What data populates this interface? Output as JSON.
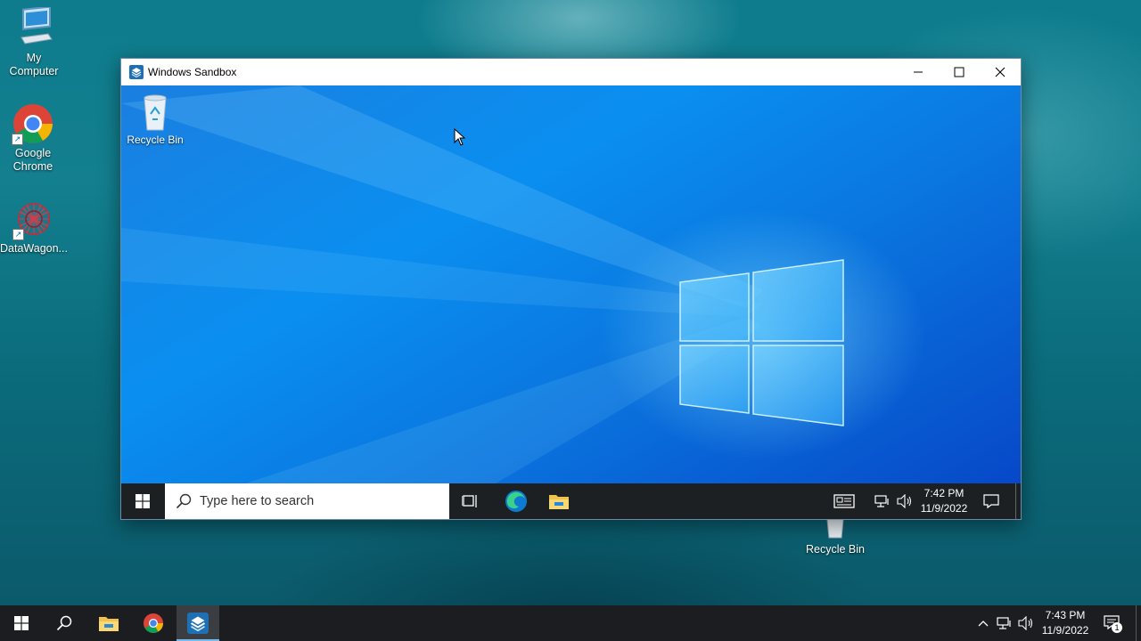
{
  "desktop": {
    "icons": [
      {
        "label": "My\nComputer",
        "icon": "computer-icon"
      },
      {
        "label": "Google\nChrome",
        "icon": "chrome-icon"
      },
      {
        "label": "DataWagon...",
        "icon": "datawagon-icon"
      }
    ],
    "behind_window_icon": {
      "label": "Recycle Bin",
      "icon": "recycle-bin-icon"
    }
  },
  "sandbox_window": {
    "title": "Windows Sandbox",
    "app_icon": "windows-sandbox-icon",
    "controls": [
      "minimize-icon",
      "maximize-icon",
      "close-icon"
    ],
    "desktop_icon": {
      "label": "Recycle Bin",
      "icon": "recycle-bin-icon"
    },
    "taskbar": {
      "search_placeholder": "Type here to search",
      "pinned": [
        "task-view-icon",
        "edge-icon",
        "file-explorer-icon"
      ],
      "tray": [
        "news-icon",
        "network-icon",
        "volume-icon"
      ],
      "time": "7:42 PM",
      "date": "11/9/2022"
    }
  },
  "host_taskbar": {
    "pinned": [
      "start-icon",
      "search-icon",
      "file-explorer-icon",
      "chrome-icon",
      "windows-sandbox-icon"
    ],
    "active_app": "Windows Sandbox",
    "time": "7:43 PM",
    "date": "11/9/2022",
    "notification_count": "1",
    "colors": {
      "accent": "#76b9ed",
      "taskbar": "#1b1d20"
    }
  }
}
